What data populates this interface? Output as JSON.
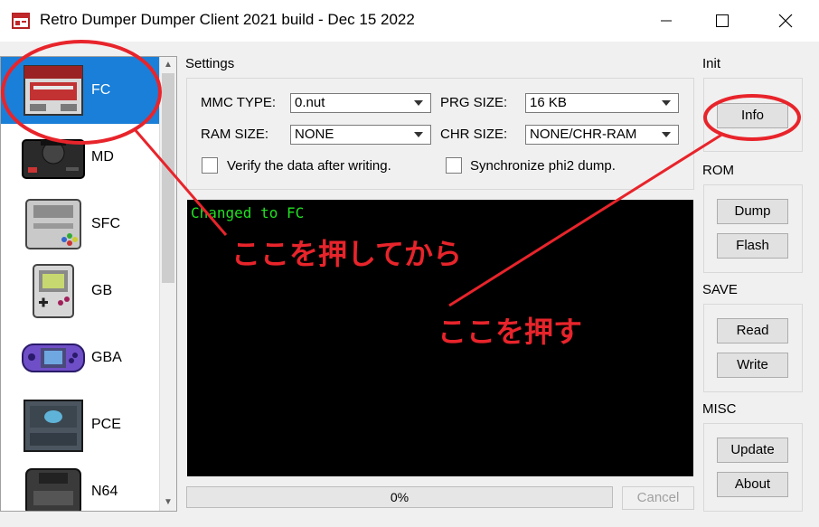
{
  "window": {
    "title": "Retro Dumper Dumper Client 2021 build - Dec 15 2022",
    "controls": [
      "minimize",
      "maximize",
      "close"
    ]
  },
  "sidebar": {
    "items": [
      {
        "label": "FC",
        "icon": "famicom-icon",
        "selected": true
      },
      {
        "label": "MD",
        "icon": "mega-drive-icon"
      },
      {
        "label": "SFC",
        "icon": "super-famicom-icon"
      },
      {
        "label": "GB",
        "icon": "game-boy-icon"
      },
      {
        "label": "GBA",
        "icon": "game-boy-advance-icon"
      },
      {
        "label": "PCE",
        "icon": "pc-engine-icon"
      },
      {
        "label": "N64",
        "icon": "nintendo-64-icon"
      }
    ]
  },
  "settings": {
    "label": "Settings",
    "mmc_type_label": "MMC TYPE:",
    "mmc_type_value": "0.nut",
    "prg_size_label": "PRG SIZE:",
    "prg_size_value": "16 KB",
    "ram_size_label": "RAM SIZE:",
    "ram_size_value": "NONE",
    "chr_size_label": "CHR SIZE:",
    "chr_size_value": "NONE/CHR-RAM",
    "verify_label": "Verify the data after writing.",
    "sync_label": "Synchronize phi2 dump."
  },
  "console": {
    "text": "Changed to FC"
  },
  "progress": {
    "text": "0%",
    "value": 0
  },
  "cancel_label": "Cancel",
  "init": {
    "label": "Init",
    "info_label": "Info"
  },
  "rom": {
    "label": "ROM",
    "dump_label": "Dump",
    "flash_label": "Flash"
  },
  "save": {
    "label": "SAVE",
    "read_label": "Read",
    "write_label": "Write"
  },
  "misc": {
    "label": "MISC",
    "update_label": "Update",
    "about_label": "About"
  },
  "annotations": {
    "first": "ここを押してから",
    "second": "ここを押す",
    "color": "#e8242b"
  },
  "colors": {
    "selection": "#1a7fd8",
    "console_text": "#22e022"
  }
}
